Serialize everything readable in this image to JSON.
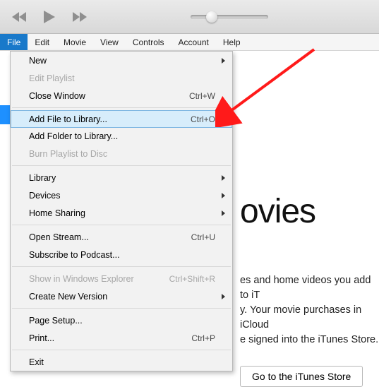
{
  "menubar": {
    "file": "File",
    "edit": "Edit",
    "movie": "Movie",
    "view": "View",
    "controls": "Controls",
    "account": "Account",
    "help": "Help"
  },
  "file_menu": {
    "new": "New",
    "edit_playlist": "Edit Playlist",
    "close_window": "Close Window",
    "close_window_accel": "Ctrl+W",
    "add_file": "Add File to Library...",
    "add_file_accel": "Ctrl+O",
    "add_folder": "Add Folder to Library...",
    "burn_playlist": "Burn Playlist to Disc",
    "library": "Library",
    "devices": "Devices",
    "home_sharing": "Home Sharing",
    "open_stream": "Open Stream...",
    "open_stream_accel": "Ctrl+U",
    "subscribe_podcast": "Subscribe to Podcast...",
    "show_explorer": "Show in Windows Explorer",
    "show_explorer_accel": "Ctrl+Shift+R",
    "create_new_version": "Create New Version",
    "page_setup": "Page Setup...",
    "print": "Print...",
    "print_accel": "Ctrl+P",
    "exit": "Exit"
  },
  "content": {
    "title_fragment": "ovies",
    "desc_line1": "es and home videos you add to iT",
    "desc_line2": "y. Your movie purchases in iCloud",
    "desc_line3": "e signed into the iTunes Store.",
    "store_button": "Go to the iTunes Store"
  }
}
